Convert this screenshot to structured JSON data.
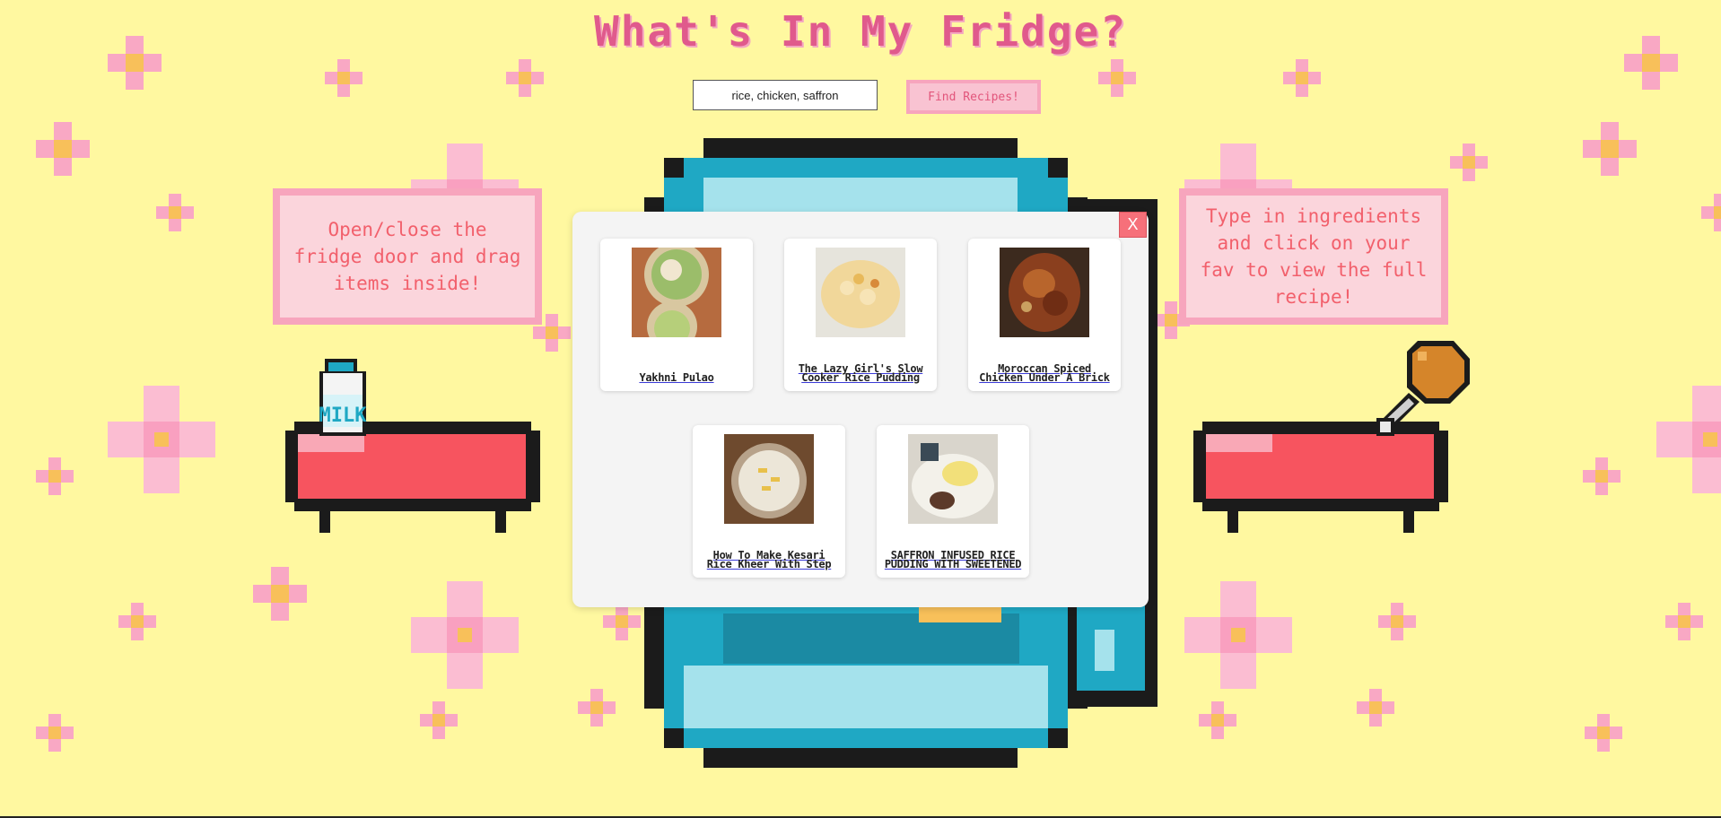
{
  "title": "What's In My Fridge?",
  "search": {
    "value": "rice, chicken, saffron",
    "button_label": "Find Recipes!"
  },
  "notes": {
    "left": "Open/close the fridge door and drag items inside!",
    "right": "Type in ingredients and click on your fav to view the full recipe!"
  },
  "milk_label": "MILK",
  "modal": {
    "close_label": "X",
    "recipes": [
      {
        "title": "Yakhni Pulao"
      },
      {
        "title": "The Lazy Girl's Slow Cooker Rice Pudding"
      },
      {
        "title": "Moroccan Spiced Chicken Under A Brick"
      },
      {
        "title": "How To Make Kesari Rice Kheer With Step"
      },
      {
        "title": "SAFFRON INFUSED RICE PUDDING WITH SWEETENED"
      }
    ]
  },
  "colors": {
    "background": "#fff8a0",
    "title": "#e05a8c",
    "note_fill": "#fbd5dc",
    "note_text": "#f2606c",
    "fridge": "#1fa8c4",
    "table": "#f7545f"
  },
  "icons": [
    "flower-icon",
    "milk-bottle-icon",
    "chicken-leg-icon",
    "close-icon"
  ]
}
